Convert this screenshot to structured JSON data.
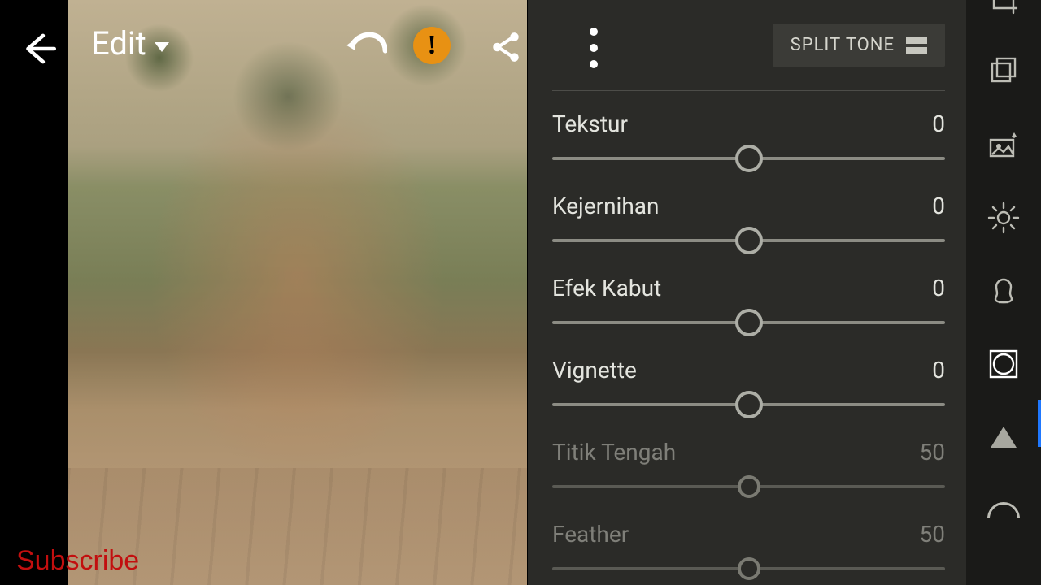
{
  "header": {
    "title": "Edit"
  },
  "panel": {
    "split_tone_label": "SPLIT TONE"
  },
  "sliders": [
    {
      "label": "Tekstur",
      "value": "0",
      "pos": 50,
      "enabled": true
    },
    {
      "label": "Kejernihan",
      "value": "0",
      "pos": 50,
      "enabled": true
    },
    {
      "label": "Efek Kabut",
      "value": "0",
      "pos": 50,
      "enabled": true
    },
    {
      "label": "Vignette",
      "value": "0",
      "pos": 50,
      "enabled": true
    },
    {
      "label": "Titik Tengah",
      "value": "50",
      "pos": 50,
      "enabled": false
    },
    {
      "label": "Feather",
      "value": "50",
      "pos": 50,
      "enabled": false
    }
  ],
  "watermark": "Subscribe",
  "tool_rail": {
    "active": "detail"
  }
}
